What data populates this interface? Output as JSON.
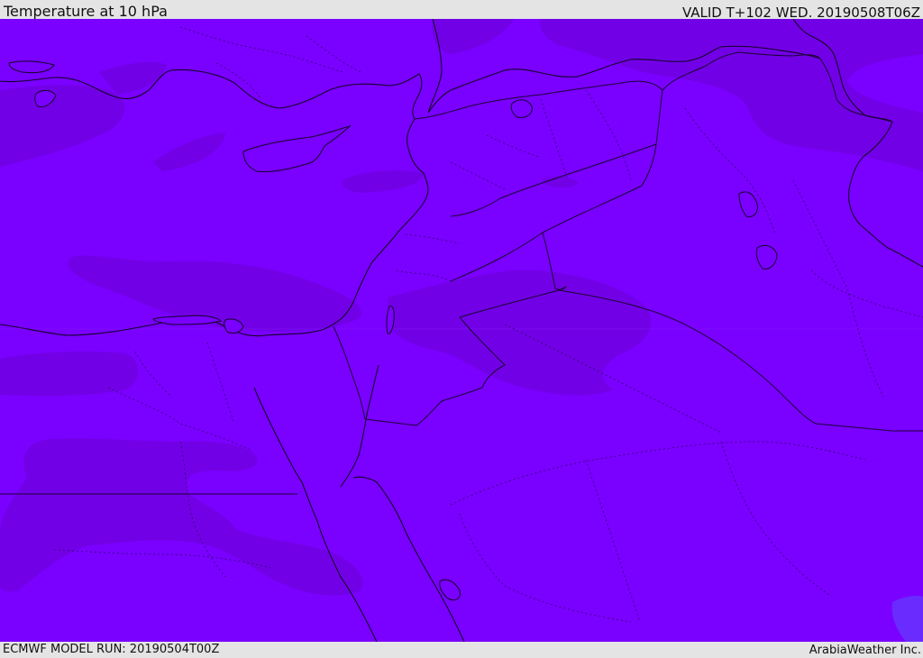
{
  "header": {
    "title": "Temperature at 10 hPa",
    "valid": "VALID T+102 WED. 20190508T06Z"
  },
  "footer": {
    "model_run": "ECMWF MODEL RUN: 20190504T00Z",
    "credit": "ArabiaWeather Inc."
  },
  "colors": {
    "field_base": "#7a00ff",
    "field_dark": "#7200e6",
    "field_blue": "#6a2bff",
    "frame": "#e4e4e4"
  }
}
